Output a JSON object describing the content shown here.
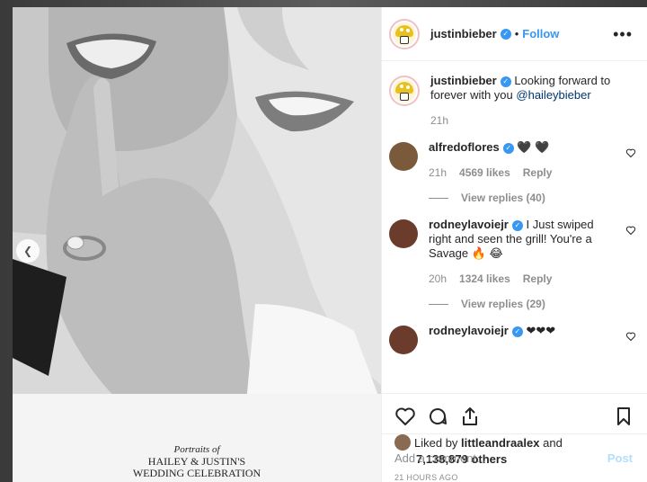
{
  "post": {
    "username": "justinbieber",
    "follow_label": "Follow",
    "more_label": "•••",
    "caption_user": "justinbieber",
    "caption_text": "Looking forward to forever with you",
    "caption_mention": "@haileybieber",
    "caption_time": "21h"
  },
  "photo": {
    "print_line1": "Portraits of",
    "print_line2": "HAILEY & JUSTIN'S",
    "print_line3": "WEDDING CELEBRATION"
  },
  "comments": [
    {
      "user": "alfredoflores",
      "text": "🖤 🖤",
      "time": "21h",
      "likes": "4569 likes",
      "reply": "Reply",
      "view_replies": "View replies (40)"
    },
    {
      "user": "rodneylavoiejr",
      "text": "I Just swiped right and seen the grill! You're a Savage 🔥 😂",
      "time": "20h",
      "likes": "1324 likes",
      "reply": "Reply",
      "view_replies": "View replies (29)"
    },
    {
      "user": "rodneylavoiejr",
      "text": "❤❤❤"
    }
  ],
  "likes": {
    "liked_by_prefix": "Liked by",
    "liked_by_user": "littleandraalex",
    "and_text": "and",
    "others": "7,138,879 others"
  },
  "timestamp": "21 HOURS AGO",
  "add_comment": {
    "placeholder": "Add a comment...",
    "post_label": "Post"
  },
  "colors": {
    "accent": "#3897f0",
    "post_disabled": "#b2dffc"
  }
}
